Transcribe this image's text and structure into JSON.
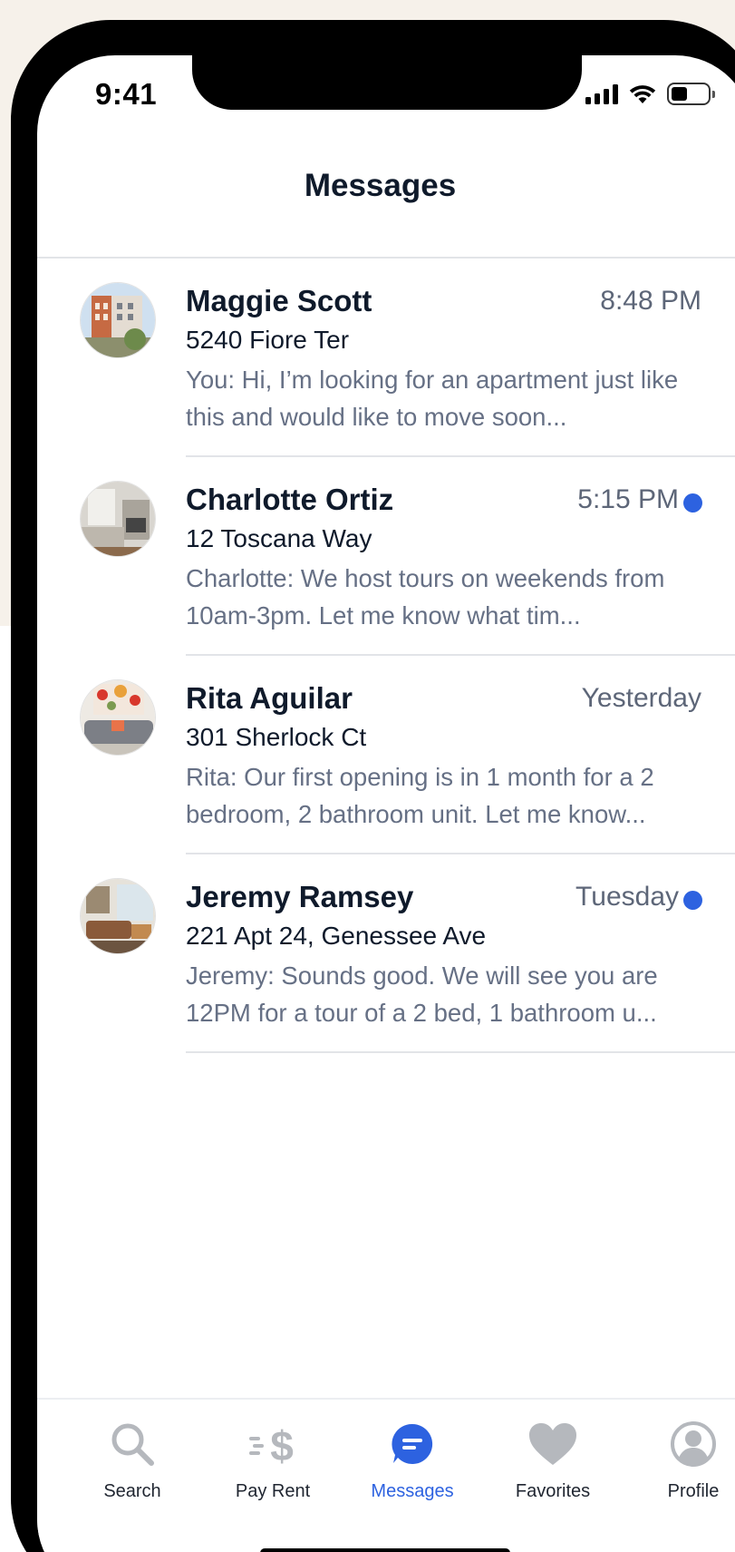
{
  "status": {
    "time": "9:41"
  },
  "header": {
    "title": "Messages"
  },
  "messages": [
    {
      "name": "Maggie Scott",
      "time": "8:48 PM",
      "unread": false,
      "address": "5240 Fiore Ter",
      "preview": "You: Hi, I’m looking for an apartment just like this and would like to move soon..."
    },
    {
      "name": "Charlotte Ortiz",
      "time": "5:15 PM",
      "unread": true,
      "address": "12 Toscana Way",
      "preview": "Charlotte: We host tours on weekends from 10am-3pm. Let me know what tim..."
    },
    {
      "name": "Rita Aguilar",
      "time": "Yesterday",
      "unread": false,
      "address": "301 Sherlock Ct",
      "preview": "Rita: Our first opening is in 1 month for a 2 bedroom, 2 bathroom unit. Let me know..."
    },
    {
      "name": "Jeremy Ramsey",
      "time": "Tuesday",
      "unread": true,
      "address": "221 Apt 24, Genessee Ave",
      "preview": "Jeremy: Sounds good. We will see you are 12PM for a tour of a 2 bed, 1 bathroom u..."
    }
  ],
  "tabs": [
    {
      "label": "Search",
      "icon": "search-icon",
      "active": false
    },
    {
      "label": "Pay Rent",
      "icon": "pay-rent-icon",
      "active": false
    },
    {
      "label": "Messages",
      "icon": "messages-icon",
      "active": true
    },
    {
      "label": "Favorites",
      "icon": "heart-icon",
      "active": false
    },
    {
      "label": "Profile",
      "icon": "profile-icon",
      "active": false
    }
  ],
  "colors": {
    "accent": "#2d62e0",
    "inactive_icon": "#b5b8bd",
    "title": "#0f1a2b",
    "muted": "#667085"
  }
}
